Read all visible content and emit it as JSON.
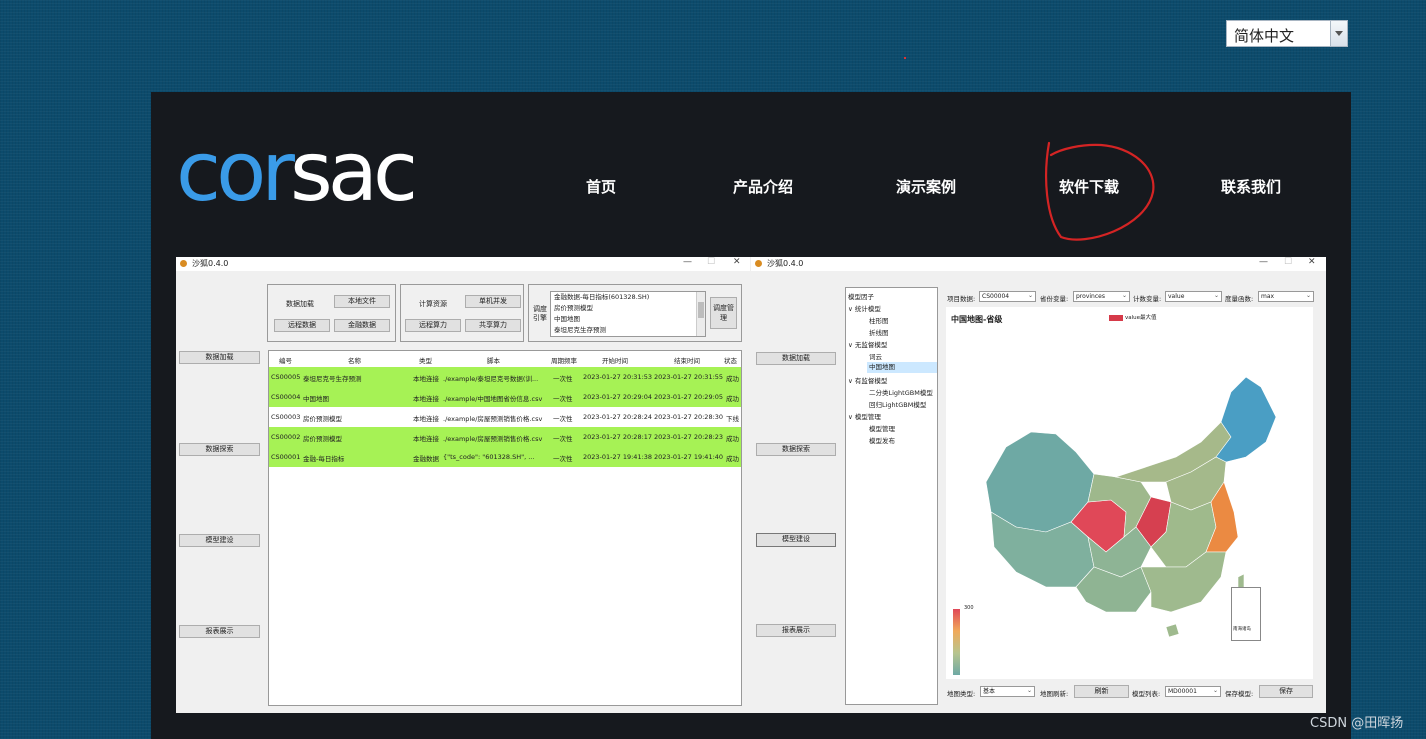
{
  "language_select": {
    "selected": "简体中文"
  },
  "site": {
    "logo": {
      "part1": "cor",
      "part2": "sac"
    },
    "nav": [
      "首页",
      "产品介绍",
      "演示案例",
      "软件下载",
      "联系我们"
    ]
  },
  "screenshot": {
    "left_window": {
      "title": "沙狐0.4.0",
      "side_buttons": [
        "数据加载",
        "数据探索",
        "模型建设",
        "报表展示"
      ],
      "group1": {
        "label": "数据加载",
        "local_file": "本地文件",
        "remote_data": "远程数据",
        "financial_data": "金融数据"
      },
      "group2": {
        "label": "计算资源",
        "single_parallel": "单机并发",
        "remote_compute": "远程算力",
        "shared_compute": "共享算力"
      },
      "scheduler": {
        "label": "调度引擎",
        "items": [
          "金融数据-每日指标(601328.SH)",
          "房价预测模型",
          "中国地图",
          "泰坦尼克生存预测"
        ],
        "manage_button": "调度管理"
      },
      "table": {
        "headers": [
          "编号",
          "名称",
          "类型",
          "脚本",
          "周期频率",
          "开始时间",
          "结束时间",
          "状态"
        ],
        "rows": [
          {
            "id": "CS00005",
            "name": "泰坦尼克号生存预测",
            "type": "本地连接",
            "script": "./example/泰坦尼克号数据(训...",
            "freq": "一次性",
            "start": "2023-01-27 20:31:53",
            "end": "2023-01-27 20:31:55",
            "status": "成功",
            "color": "#a6f255"
          },
          {
            "id": "CS00004",
            "name": "中国地图",
            "type": "本地连接",
            "script": "./example/中国地图省份信息.csv",
            "freq": "一次性",
            "start": "2023-01-27 20:29:04",
            "end": "2023-01-27 20:29:05",
            "status": "成功",
            "color": "#a6f255"
          },
          {
            "id": "CS00003",
            "name": "房价预测模型",
            "type": "本地连接",
            "script": "./example/房屋预测销售价格.csv",
            "freq": "一次性",
            "start": "2023-01-27 20:28:24",
            "end": "2023-01-27 20:28:30",
            "status": "下线",
            "color": "#ffffff"
          },
          {
            "id": "CS00002",
            "name": "房价预测模型",
            "type": "本地连接",
            "script": "./example/房屋预测销售价格.csv",
            "freq": "一次性",
            "start": "2023-01-27 20:28:17",
            "end": "2023-01-27 20:28:23",
            "status": "成功",
            "color": "#a6f255"
          },
          {
            "id": "CS00001",
            "name": "金融-每日指标",
            "type": "金融数据",
            "script": "{\"ts_code\": \"601328.SH\", ...",
            "freq": "一次性",
            "start": "2023-01-27 19:41:38",
            "end": "2023-01-27 19:41:40",
            "status": "成功",
            "color": "#a6f255"
          }
        ]
      }
    },
    "right_window": {
      "title": "沙狐0.4.0",
      "side_buttons": [
        "数据加载",
        "数据探索",
        "模型建设",
        "报表展示"
      ],
      "tree": [
        "模型因子",
        "统计模型",
        "柱形图",
        "折线图",
        "无监督模型",
        "词云",
        "中国地图",
        "有监督模型",
        "二分类LightGBM模型",
        "回归LightGBM模型",
        "模型管理",
        "模型管理",
        "模型发布"
      ],
      "params": {
        "project_label": "项目数据:",
        "project_value": "CS00004",
        "province_label": "省份变量:",
        "province_value": "provinces",
        "count_label": "计数变量:",
        "count_value": "value",
        "metric_label": "度量函数:",
        "metric_value": "max"
      },
      "map": {
        "title": "中国地图-省级",
        "legend": "value最大值",
        "scale_max": "300",
        "inset_label": "南海诸岛"
      },
      "bottom": {
        "map_type_label": "地图类型:",
        "map_type_value": "基本",
        "refresh_label": "地图刷新:",
        "refresh_button": "刷新",
        "model_list_label": "模型列表:",
        "model_list_value": "MD00001",
        "save_label": "保存模型:",
        "save_button": "保存"
      }
    }
  },
  "watermark": "CSDN @田晖扬"
}
